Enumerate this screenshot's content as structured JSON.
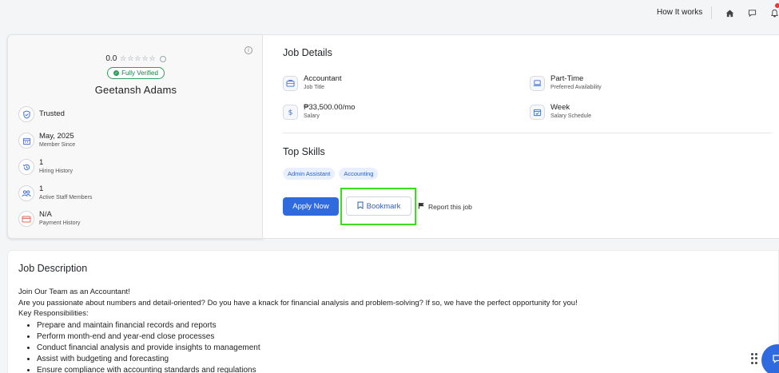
{
  "nav": {
    "how_it_works": "How It works"
  },
  "profile": {
    "rating": "0.0",
    "stars": "☆☆☆☆☆",
    "verified_label": "Fully Verified",
    "name": "Geetansh Adams",
    "stats": [
      {
        "value": "Trusted",
        "label": ""
      },
      {
        "value": "May, 2025",
        "label": "Member Since"
      },
      {
        "value": "1",
        "label": "Hiring History"
      },
      {
        "value": "1",
        "label": "Active Staff Members"
      },
      {
        "value": "N/A",
        "label": "Payment History"
      }
    ]
  },
  "job_details": {
    "title": "Job Details",
    "items": [
      {
        "value": "Accountant",
        "label": "Job Title",
        "icon": "briefcase-icon"
      },
      {
        "value": "Part-Time",
        "label": "Preferred Availability",
        "icon": "laptop-icon"
      },
      {
        "value": "₱33,500.00/mo",
        "label": "Salary",
        "icon": "dollar-icon"
      },
      {
        "value": "Week",
        "label": "Salary Schedule",
        "icon": "calendar-icon"
      }
    ]
  },
  "skills": {
    "title": "Top Skills",
    "items": [
      "Admin Assistant",
      "Accounting"
    ]
  },
  "actions": {
    "apply": "Apply Now",
    "bookmark": "Bookmark",
    "report": "Report this job"
  },
  "description": {
    "title": "Job Description",
    "intro": "Join Our Team as an Accountant!",
    "lead": "Are you passionate about numbers and detail-oriented? Do you have a knack for financial analysis and problem-solving? If so, we have the perfect opportunity for you!",
    "responsibilities_heading": "Key Responsibilities:",
    "responsibilities": [
      "Prepare and maintain financial records and reports",
      "Perform month-end and year-end close processes",
      "Conduct financial analysis and provide insights to management",
      "Assist with budgeting and forecasting",
      "Ensure compliance with accounting standards and regulations"
    ]
  },
  "colors": {
    "primary": "#2f6bdf",
    "verified": "#2e9e5b",
    "highlight": "#3ddc1f"
  }
}
